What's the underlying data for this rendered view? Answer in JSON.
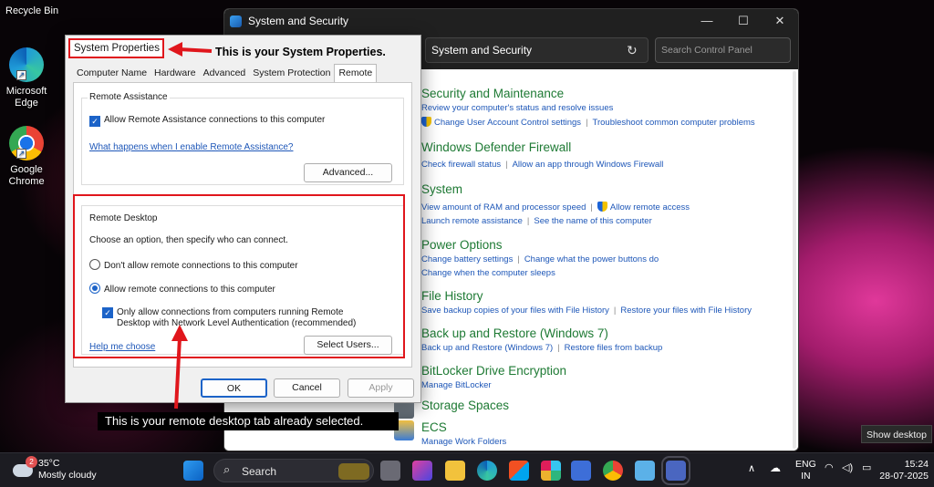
{
  "desktop": {
    "recycle_bin": "Recycle Bin",
    "edge": "Microsoft\nEdge",
    "chrome": "Google\nChrome",
    "show_desktop": "Show desktop"
  },
  "control_panel": {
    "title": "System and Security",
    "address": "System and Security",
    "search_placeholder": "Search Control Panel",
    "categories": [
      {
        "title": "Security and Maintenance",
        "links": [
          "Review your computer's status and resolve issues"
        ],
        "links2": [
          "Change User Account Control settings",
          "Troubleshoot common computer problems"
        ]
      },
      {
        "title": "Windows Defender Firewall",
        "links": [
          "Check firewall status",
          "Allow an app through Windows Firewall"
        ]
      },
      {
        "title": "System",
        "links": [
          "View amount of RAM and processor speed",
          "Allow remote access"
        ],
        "links2": [
          "Launch remote assistance",
          "See the name of this computer"
        ]
      },
      {
        "title": "Power Options",
        "links": [
          "Change battery settings",
          "Change what the power buttons do"
        ],
        "links2": [
          "Change when the computer sleeps"
        ]
      },
      {
        "title": "File History",
        "links": [
          "Save backup copies of your files with File History",
          "Restore your files with File History"
        ]
      },
      {
        "title": "Back up and Restore (Windows 7)",
        "links": [
          "Back up and Restore (Windows 7)",
          "Restore files from backup"
        ]
      },
      {
        "title": "BitLocker Drive Encryption",
        "links": [
          "Manage BitLocker"
        ]
      },
      {
        "title": "Storage Spaces"
      },
      {
        "title": "ECS",
        "links": [
          "Manage Work Folders"
        ]
      }
    ]
  },
  "system_properties": {
    "title": "System Properties",
    "tabs": [
      "Computer Name",
      "Hardware",
      "Advanced",
      "System Protection",
      "Remote"
    ],
    "remote_assistance": {
      "group": "Remote Assistance",
      "checkbox": "Allow Remote Assistance connections to this computer",
      "link": "What happens when I enable Remote Assistance?",
      "advanced_button": "Advanced..."
    },
    "remote_desktop": {
      "group": "Remote Desktop",
      "instruction": "Choose an option, then specify who can connect.",
      "option1": "Don't allow remote connections to this computer",
      "option2": "Allow remote connections to this computer",
      "nla_line1": "Only allow connections from computers running Remote",
      "nla_line2": "Desktop with Network Level Authentication (recommended)",
      "help_link": "Help me choose",
      "select_users_button": "Select Users..."
    },
    "buttons": {
      "ok": "OK",
      "cancel": "Cancel",
      "apply": "Apply"
    }
  },
  "annotations": {
    "top": "This is your System Properties.",
    "bottom": "This is your remote desktop tab already selected."
  },
  "taskbar": {
    "weather_temp": "35°C",
    "weather_desc": "Mostly cloudy",
    "weather_badge": "2",
    "search": "Search",
    "lang1": "ENG",
    "lang2": "IN",
    "time": "15:24",
    "date": "28-07-2025"
  }
}
